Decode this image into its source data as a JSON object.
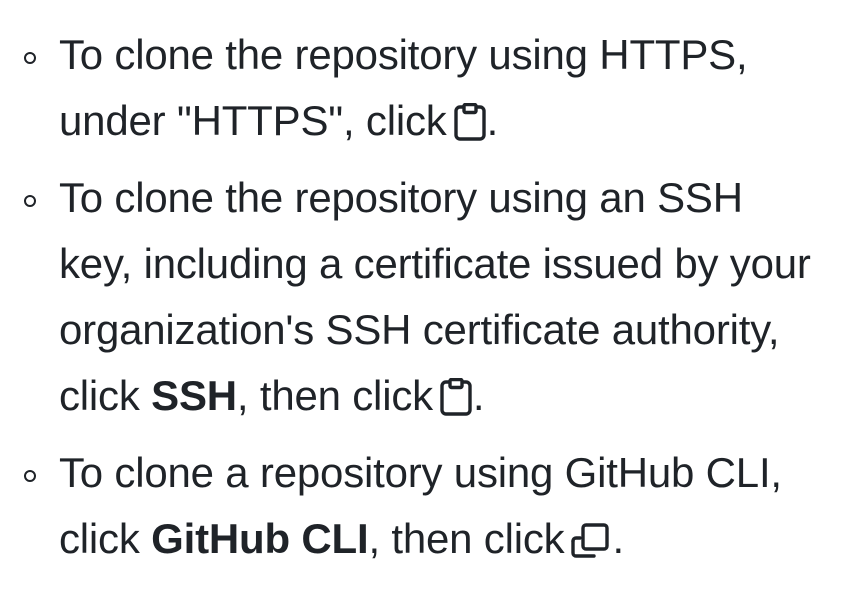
{
  "items": [
    {
      "line1": "To clone the repository using HTTPS,",
      "line2_text": "under \"HTTPS\", click",
      "line2_suffix": ".",
      "icon": "clipboard-icon"
    },
    {
      "line1": "To clone the repository using an SSH",
      "line2": "key, including a certificate issued by your",
      "line3": "organization's SSH certificate authority,",
      "line4_prefix": "click ",
      "line4_bold": "SSH",
      "line4_mid": ", then click",
      "line4_suffix": ".",
      "icon": "clipboard-icon"
    },
    {
      "line1": "To clone a repository using GitHub CLI,",
      "line2_prefix": "click ",
      "line2_bold": "GitHub CLI",
      "line2_mid": ", then click",
      "line2_suffix": ".",
      "icon": "copy-icon"
    }
  ]
}
